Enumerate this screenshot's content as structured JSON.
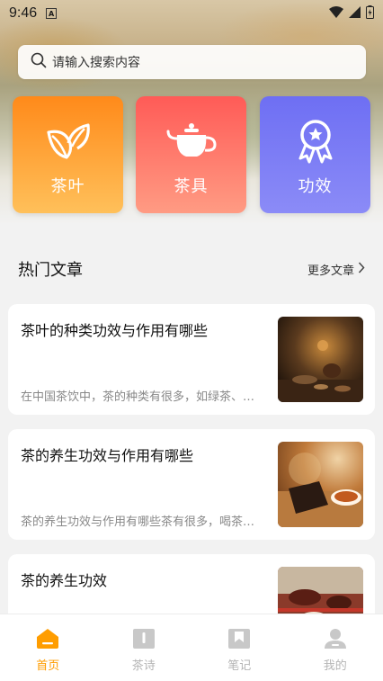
{
  "status_bar": {
    "time": "9:46",
    "indicator": "A",
    "icons": [
      "wifi-icon",
      "signal-icon",
      "battery-icon"
    ]
  },
  "search": {
    "placeholder": "请输入搜索内容",
    "icon": "search-icon"
  },
  "categories": [
    {
      "label": "茶叶",
      "icon": "tea-leaf-icon",
      "colors": [
        "#ff8a1a",
        "#ffc05a"
      ]
    },
    {
      "label": "茶具",
      "icon": "teapot-icon",
      "colors": [
        "#ff5b57",
        "#ff9b83"
      ]
    },
    {
      "label": "功效",
      "icon": "award-medal-icon",
      "colors": [
        "#6e6ff3",
        "#8b8bf7"
      ]
    }
  ],
  "articles_section": {
    "title": "热门文章",
    "more_label": "更多文章"
  },
  "articles": [
    {
      "title": "茶叶的种类功效与作用有哪些",
      "summary": "在中国茶饮中，茶的种类有很多，如绿茶、红茶、",
      "thumb": "tea-ceremony-photo"
    },
    {
      "title": "茶的养生功效与作用有哪些",
      "summary": "茶的养生功效与作用有哪些茶有很多，喝茶能养生",
      "thumb": "tea-brick-photo"
    },
    {
      "title": "茶的养生功效",
      "summary": "",
      "thumb": "teapot-table-photo"
    }
  ],
  "tab_bar": {
    "accent": "#ff9d00",
    "inactive_color": "#b5b5b5",
    "items": [
      {
        "label": "首页",
        "icon": "home-icon",
        "active": true
      },
      {
        "label": "茶诗",
        "icon": "book-icon",
        "active": false
      },
      {
        "label": "笔记",
        "icon": "bookmark-icon",
        "active": false
      },
      {
        "label": "我的",
        "icon": "user-icon",
        "active": false
      }
    ]
  }
}
